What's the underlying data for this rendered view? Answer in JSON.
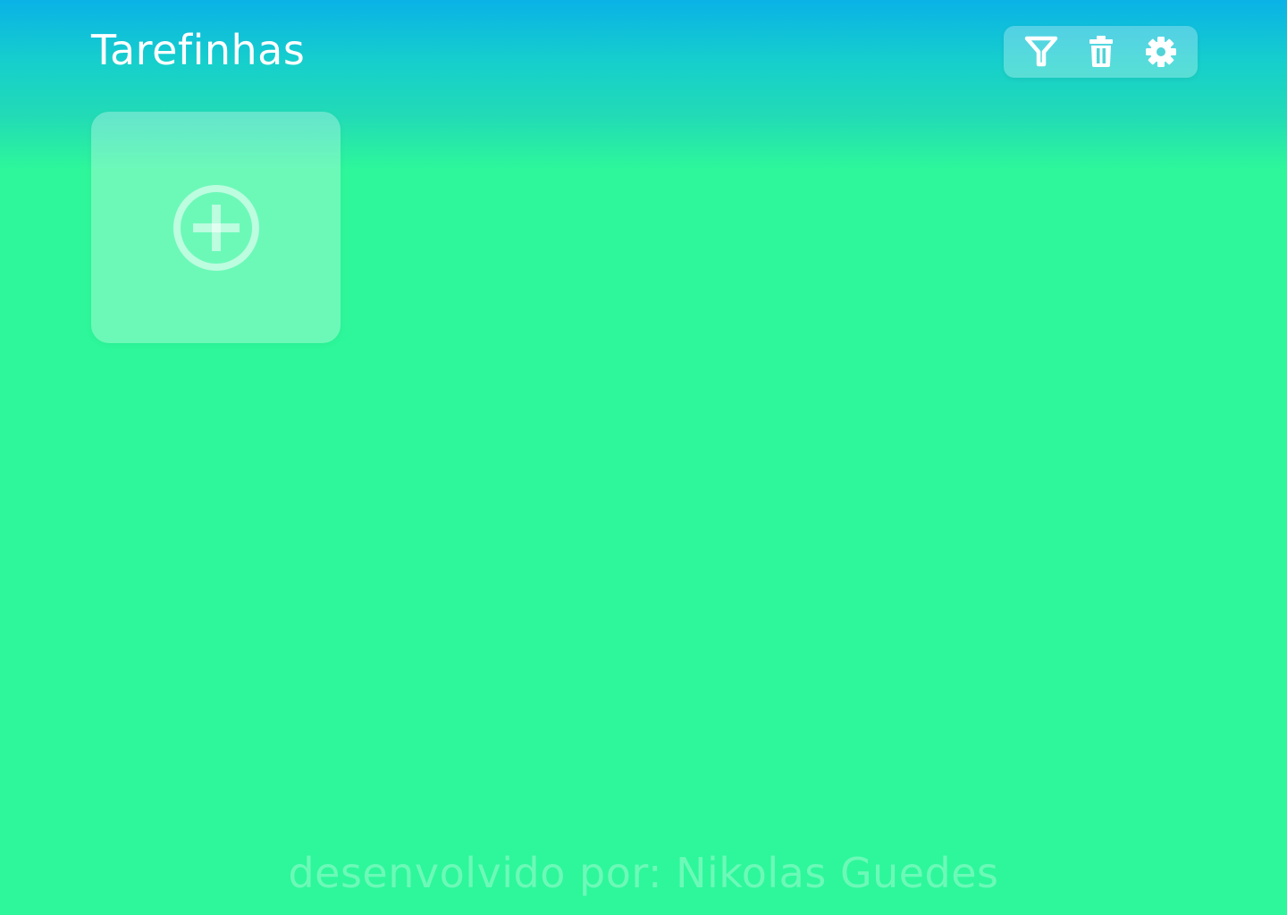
{
  "header": {
    "title": "Tarefinhas"
  },
  "toolbar": {
    "buttons": [
      {
        "icon": "filter-icon"
      },
      {
        "icon": "trash-icon"
      },
      {
        "icon": "gear-icon"
      }
    ]
  },
  "main": {
    "add_card": {
      "icon": "plus-circle-icon"
    }
  },
  "footer": {
    "text": "desenvolvido por: Nikolas Guedes"
  },
  "colors": {
    "gradient_top": "#0ab2e6",
    "gradient_bottom": "#2df79a",
    "text": "#ffffff"
  }
}
